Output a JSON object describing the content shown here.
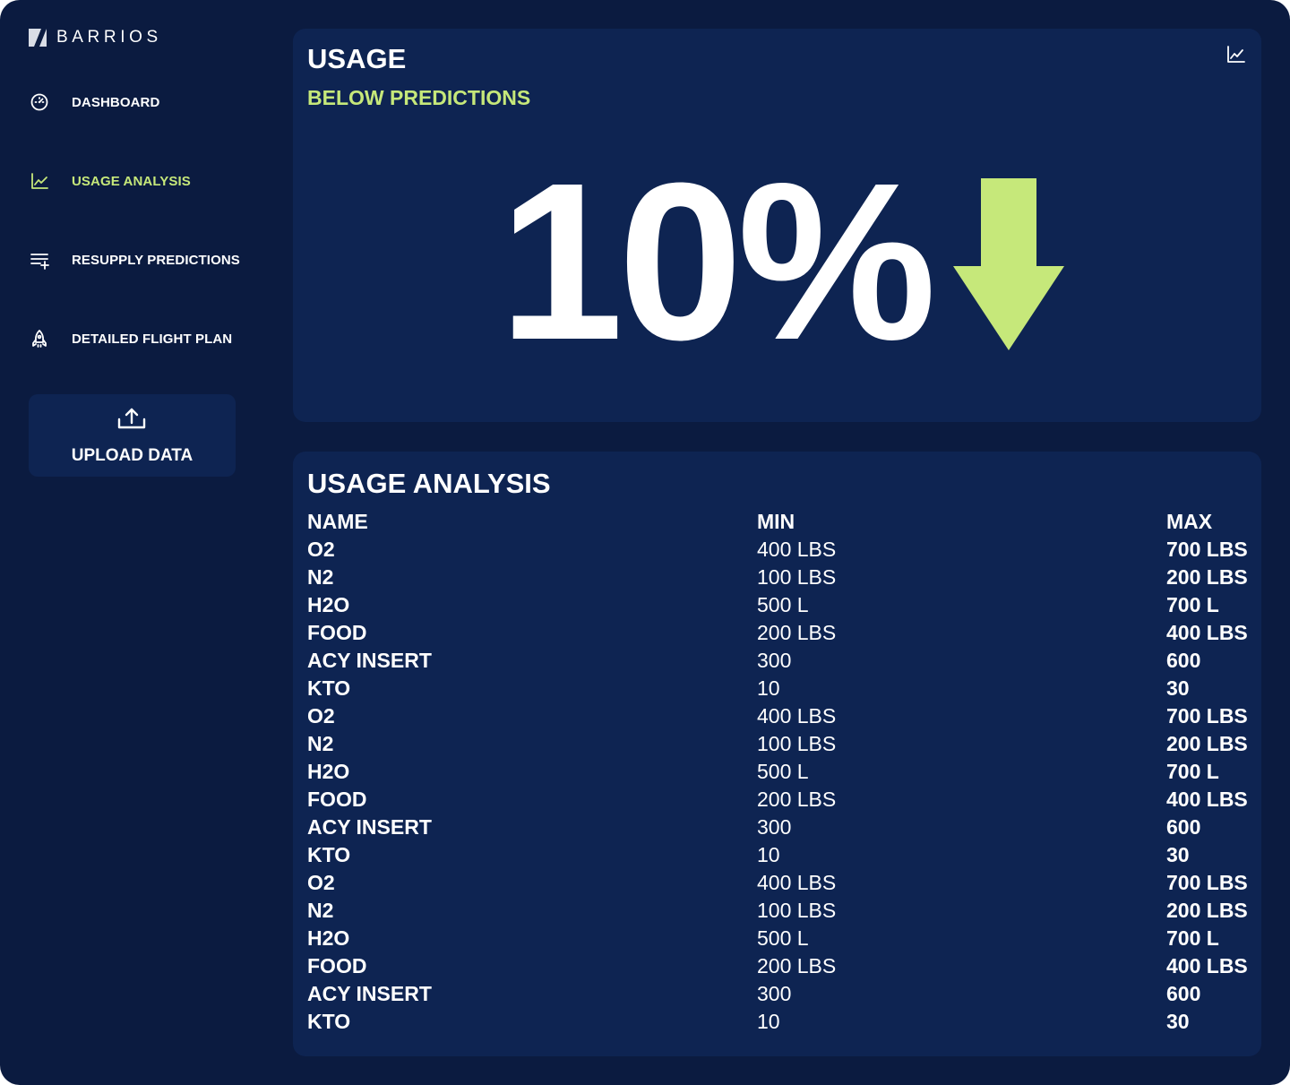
{
  "app": {
    "brand": "BARRIOS"
  },
  "sidebar": {
    "items": [
      {
        "label": "DASHBOARD",
        "icon": "gauge-icon",
        "active": false
      },
      {
        "label": "USAGE ANALYSIS",
        "icon": "line-chart-icon",
        "active": true
      },
      {
        "label": "RESUPPLY PREDICTIONS",
        "icon": "playlist-add-icon",
        "active": false
      },
      {
        "label": "DETAILED FLIGHT PLAN",
        "icon": "rocket-icon",
        "active": false
      }
    ],
    "upload_label": "UPLOAD DATA"
  },
  "usage": {
    "title": "USAGE",
    "subtitle": "BELOW PREDICTIONS",
    "value": "10%",
    "trend": "down"
  },
  "analysis": {
    "title": "USAGE ANALYSIS",
    "columns": [
      "NAME",
      "MIN",
      "MAX"
    ],
    "rows": [
      [
        "O2",
        "400 LBS",
        "700 LBS"
      ],
      [
        "N2",
        "100 LBS",
        "200 LBS"
      ],
      [
        "H2O",
        "500 L",
        "700 L"
      ],
      [
        "FOOD",
        "200 LBS",
        "400 LBS"
      ],
      [
        "ACY INSERT",
        "300",
        "600"
      ],
      [
        "KTO",
        "10",
        "30"
      ],
      [
        "O2",
        "400 LBS",
        "700 LBS"
      ],
      [
        "N2",
        "100 LBS",
        "200 LBS"
      ],
      [
        "H2O",
        "500 L",
        "700 L"
      ],
      [
        "FOOD",
        "200 LBS",
        "400 LBS"
      ],
      [
        "ACY INSERT",
        "300",
        "600"
      ],
      [
        "KTO",
        "10",
        "30"
      ],
      [
        "O2",
        "400 LBS",
        "700 LBS"
      ],
      [
        "N2",
        "100 LBS",
        "200 LBS"
      ],
      [
        "H2O",
        "500 L",
        "700 L"
      ],
      [
        "FOOD",
        "200 LBS",
        "400 LBS"
      ],
      [
        "ACY INSERT",
        "300",
        "600"
      ],
      [
        "KTO",
        "10",
        "30"
      ]
    ]
  },
  "colors": {
    "background": "#0b1b40",
    "card": "#0e2452",
    "accent": "#c6e87a",
    "text": "#ffffff"
  }
}
